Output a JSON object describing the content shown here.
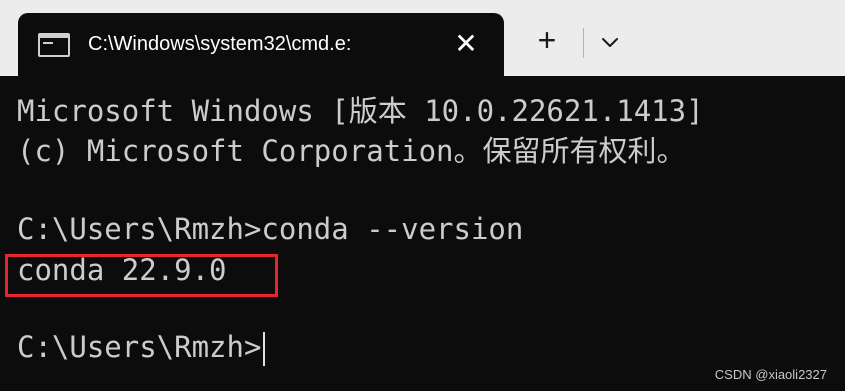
{
  "tab": {
    "title": "C:\\Windows\\system32\\cmd.e:",
    "icon": "terminal-icon",
    "close_symbol": "✕"
  },
  "toolbar": {
    "new_tab_symbol": "+",
    "dropdown_icon": "chevron-down-icon"
  },
  "terminal": {
    "lines": [
      "Microsoft Windows [版本 10.0.22621.1413]",
      "(c) Microsoft Corporation。保留所有权利。",
      "C:\\Users\\Rmzh>conda --version",
      "conda 22.9.0",
      "C:\\Users\\Rmzh>"
    ]
  },
  "highlight": {
    "color": "#e8252d"
  },
  "watermark": "CSDN @xiaoli2327"
}
